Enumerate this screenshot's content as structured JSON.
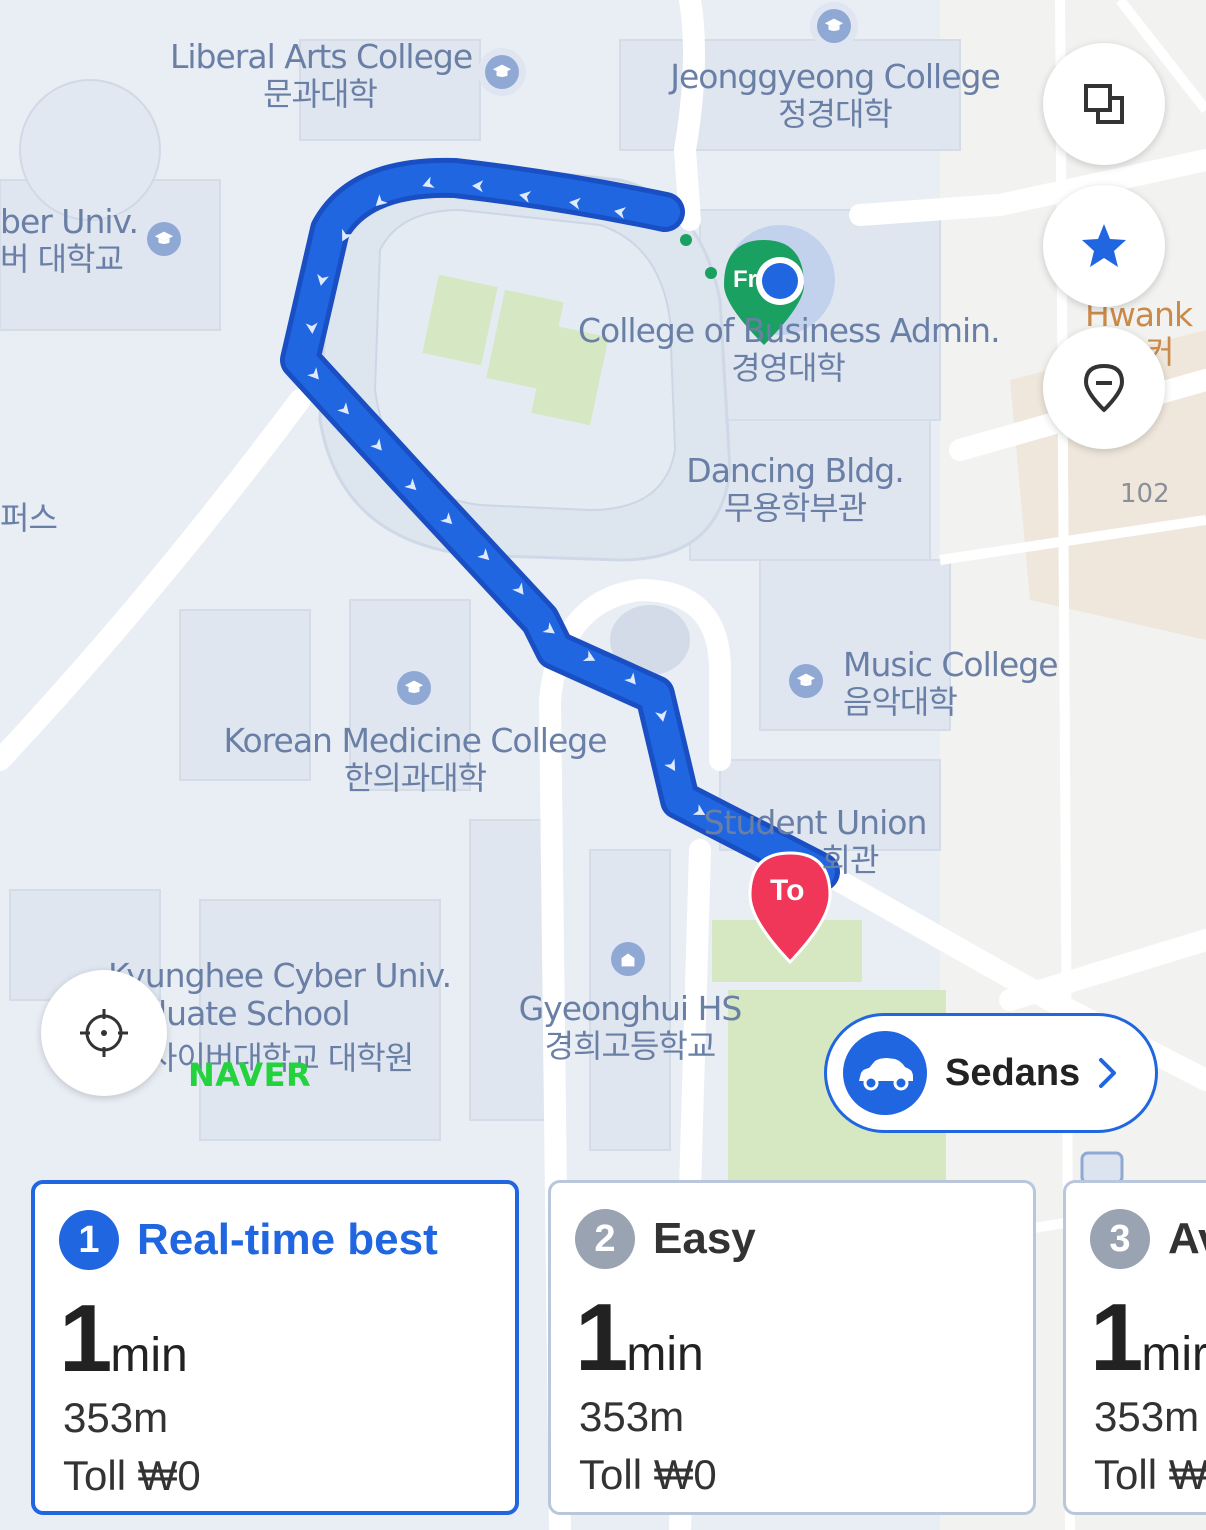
{
  "map": {
    "labels": [
      {
        "id": "liberal-arts",
        "en": "Liberal Arts College",
        "ko": "문과대학"
      },
      {
        "id": "jeonggyeong",
        "en": "Jeonggyeong College",
        "ko": "정경대학"
      },
      {
        "id": "cyber-univ",
        "en": "ber Univ.",
        "ko": "버 대학교"
      },
      {
        "id": "business-admin",
        "en": "College of Business Admin.",
        "ko": "경영대학"
      },
      {
        "id": "dancing",
        "en": "Dancing Bldg.",
        "ko": "무용학부관"
      },
      {
        "id": "music",
        "en": "Music College",
        "ko": "음악대학"
      },
      {
        "id": "korean-medicine",
        "en": "Korean Medicine College",
        "ko": "한의과대학"
      },
      {
        "id": "student-union",
        "en": "Student Union",
        "ko": "회관"
      },
      {
        "id": "cyber-grad",
        "en": "Kyunghee Cyber Univ.",
        "ko": "luate School"
      },
      {
        "id": "cyber-grad-ko",
        "en": "사이버대학교 대학원",
        "ko": ""
      },
      {
        "id": "gyeonghui-hs",
        "en": "Gyeonghui HS",
        "ko": "경희고등학교"
      },
      {
        "id": "hwank",
        "en": "Hwank",
        "ko": "커"
      },
      {
        "id": "left-edge",
        "en": "퍼스",
        "ko": ""
      }
    ],
    "building_number": "102",
    "origin_marker": "Fr",
    "destination_marker": "To",
    "watermark": "NAVER"
  },
  "controls": {
    "layers_icon": "layers-icon",
    "favorites_icon": "star-icon",
    "marker_icon": "map-pin-minus-icon",
    "locate_icon": "crosshair-icon"
  },
  "vehicle": {
    "label": "Sedans",
    "icon": "car-icon"
  },
  "routes": [
    {
      "rank": "1",
      "name": "Real-time best",
      "time": "1",
      "unit": "min",
      "distance": "353m",
      "toll": "Toll ₩0",
      "active": true
    },
    {
      "rank": "2",
      "name": "Easy",
      "time": "1",
      "unit": "min",
      "distance": "353m",
      "toll": "Toll ₩0",
      "active": false
    },
    {
      "rank": "3",
      "name": "Av",
      "time": "1",
      "unit": "mir",
      "distance": "353m",
      "toll": "Toll ₩",
      "active": false
    }
  ],
  "colors": {
    "route": "#1f66e0",
    "origin": "#1aa060",
    "destination": "#f0375a",
    "accent": "#1f66e0"
  }
}
